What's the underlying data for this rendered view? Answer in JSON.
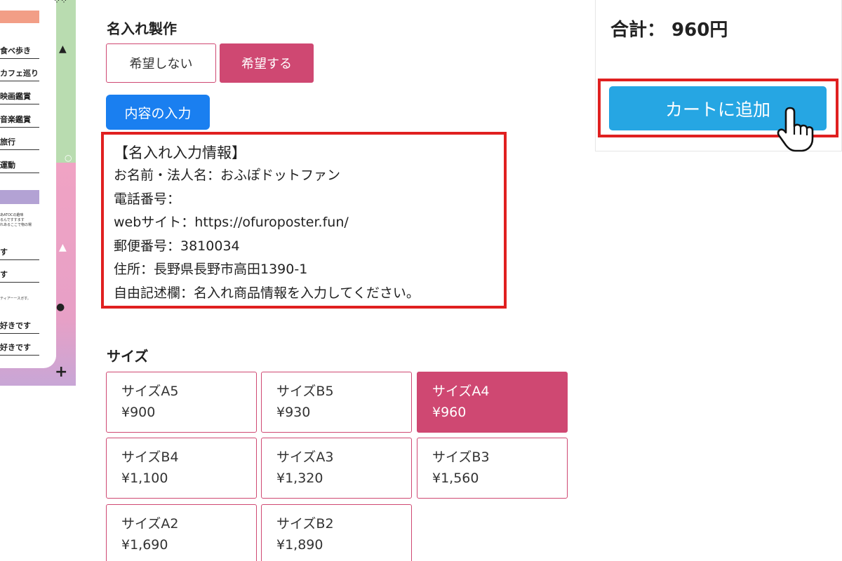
{
  "preview": {
    "items": [
      "食べ歩き",
      "カフェ巡り",
      "映画鑑賞",
      "音楽鑑賞",
      "旅行",
      "運動"
    ],
    "tiny_text": [
      "あATOCの趣味",
      "るんですすます",
      "れあるここで物の場"
    ],
    "likes": [
      "す",
      "す",
      "好きです",
      "好きです"
    ],
    "small_note": "ティアーースガす。"
  },
  "engraving": {
    "title": "名入れ製作",
    "options": [
      {
        "label": "希望しない",
        "selected": false
      },
      {
        "label": "希望する",
        "selected": true
      }
    ],
    "input_button": "内容の入力"
  },
  "info": {
    "heading": "【名入れ入力情報】",
    "lines": [
      "お名前・法人名：おふぽドットファン",
      "電話番号：",
      "webサイト：https://ofuroposter.fun/",
      "郵便番号：3810034",
      "住所：長野県長野市高田1390-1",
      "自由記述欄：名入れ商品情報を入力してください。"
    ]
  },
  "size": {
    "title": "サイズ",
    "options": [
      {
        "name": "サイズA5",
        "price": "¥900",
        "selected": false
      },
      {
        "name": "サイズB5",
        "price": "¥930",
        "selected": false
      },
      {
        "name": "サイズA4",
        "price": "¥960",
        "selected": true
      },
      {
        "name": "サイズB4",
        "price": "¥1,100",
        "selected": false
      },
      {
        "name": "サイズA3",
        "price": "¥1,320",
        "selected": false
      },
      {
        "name": "サイズB3",
        "price": "¥1,560",
        "selected": false
      },
      {
        "name": "サイズA2",
        "price": "¥1,690",
        "selected": false
      },
      {
        "name": "サイズB2",
        "price": "¥1,890",
        "selected": false
      }
    ]
  },
  "summary": {
    "total": "合計： 960円",
    "add_to_cart": "カートに追加"
  },
  "colors": {
    "accent_pink": "#cf4872",
    "button_blue": "#1a7ff0",
    "cart_blue": "#26a6e3",
    "highlight_red": "#e02020"
  },
  "icons": [
    "pointer-hand-icon"
  ]
}
